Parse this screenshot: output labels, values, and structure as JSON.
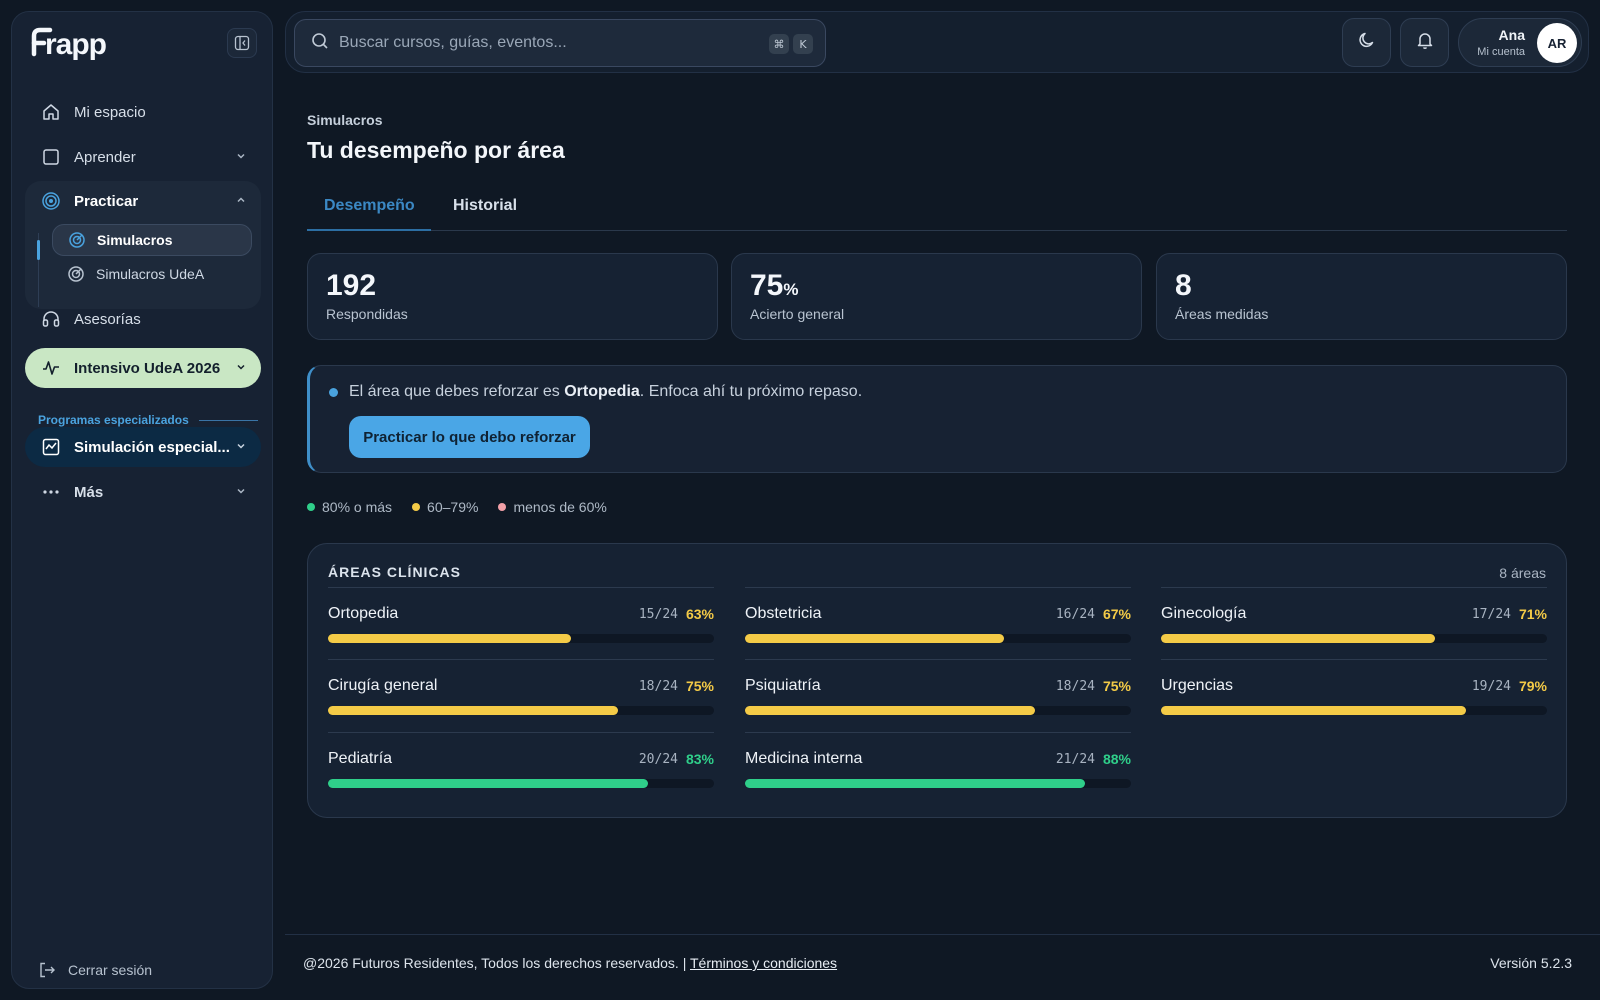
{
  "brand": {
    "logo_text": "Frapp"
  },
  "sidebar": {
    "items": [
      {
        "label": "Mi espacio"
      },
      {
        "label": "Aprender"
      },
      {
        "label": "Practicar"
      },
      {
        "label": "Asesorías"
      },
      {
        "label": "Intensivo UdeA 2026"
      },
      {
        "label": "Simulación especial..."
      },
      {
        "label": "Más"
      }
    ],
    "subitems": [
      {
        "label": "Simulacros"
      },
      {
        "label": "Simulacros UdeA"
      }
    ],
    "section_label": "Programas especializados",
    "logout_label": "Cerrar sesión"
  },
  "search": {
    "placeholder": "Buscar cursos, guías, eventos...",
    "shortcut": [
      "⌘",
      "K"
    ]
  },
  "account": {
    "name": "Ana",
    "subtitle": "Mi cuenta",
    "initials": "AR"
  },
  "page": {
    "eyebrow": "Simulacros",
    "title": "Tu desempeño por área"
  },
  "tabs": [
    {
      "label": "Desempeño"
    },
    {
      "label": "Historial"
    }
  ],
  "stats": [
    {
      "value": "192",
      "suffix": "",
      "label": "Respondidas"
    },
    {
      "value": "75",
      "suffix": "%",
      "label": "Acierto general"
    },
    {
      "value": "8",
      "suffix": "",
      "label": "Áreas medidas"
    }
  ],
  "alert": {
    "prefix": "El área que debes reforzar es ",
    "area": "Ortopedia",
    "suffix": ". Enfoca ahí tu próximo repaso.",
    "cta": "Practicar lo que debo reforzar"
  },
  "legend": [
    {
      "label": "80% o más",
      "color": "#2fcf8a"
    },
    {
      "label": "60–79%",
      "color": "#f4cb47"
    },
    {
      "label": "menos de 60%",
      "color": "#f2a0a8"
    }
  ],
  "areas": {
    "title": "ÁREAS CLÍNICAS",
    "count": "8 áreas",
    "items": [
      {
        "name": "Ortopedia",
        "fraction": "15/24",
        "percent": "63%",
        "value": 0.63,
        "color": "#f4cb47"
      },
      {
        "name": "Obstetricia",
        "fraction": "16/24",
        "percent": "67%",
        "value": 0.67,
        "color": "#f4cb47"
      },
      {
        "name": "Ginecología",
        "fraction": "17/24",
        "percent": "71%",
        "value": 0.71,
        "color": "#f4cb47"
      },
      {
        "name": "Cirugía general",
        "fraction": "18/24",
        "percent": "75%",
        "value": 0.75,
        "color": "#f4cb47"
      },
      {
        "name": "Psiquiatría",
        "fraction": "18/24",
        "percent": "75%",
        "value": 0.75,
        "color": "#f4cb47"
      },
      {
        "name": "Urgencias",
        "fraction": "19/24",
        "percent": "79%",
        "value": 0.79,
        "color": "#f4cb47"
      },
      {
        "name": "Pediatría",
        "fraction": "20/24",
        "percent": "83%",
        "value": 0.83,
        "color": "#2fcf8a"
      },
      {
        "name": "Medicina interna",
        "fraction": "21/24",
        "percent": "88%",
        "value": 0.88,
        "color": "#2fcf8a"
      }
    ]
  },
  "footer": {
    "copyright": "@2026 Futuros Residentes, Todos los derechos reservados. | ",
    "terms": "Términos y condiciones",
    "version": "Versión 5.2.3"
  }
}
